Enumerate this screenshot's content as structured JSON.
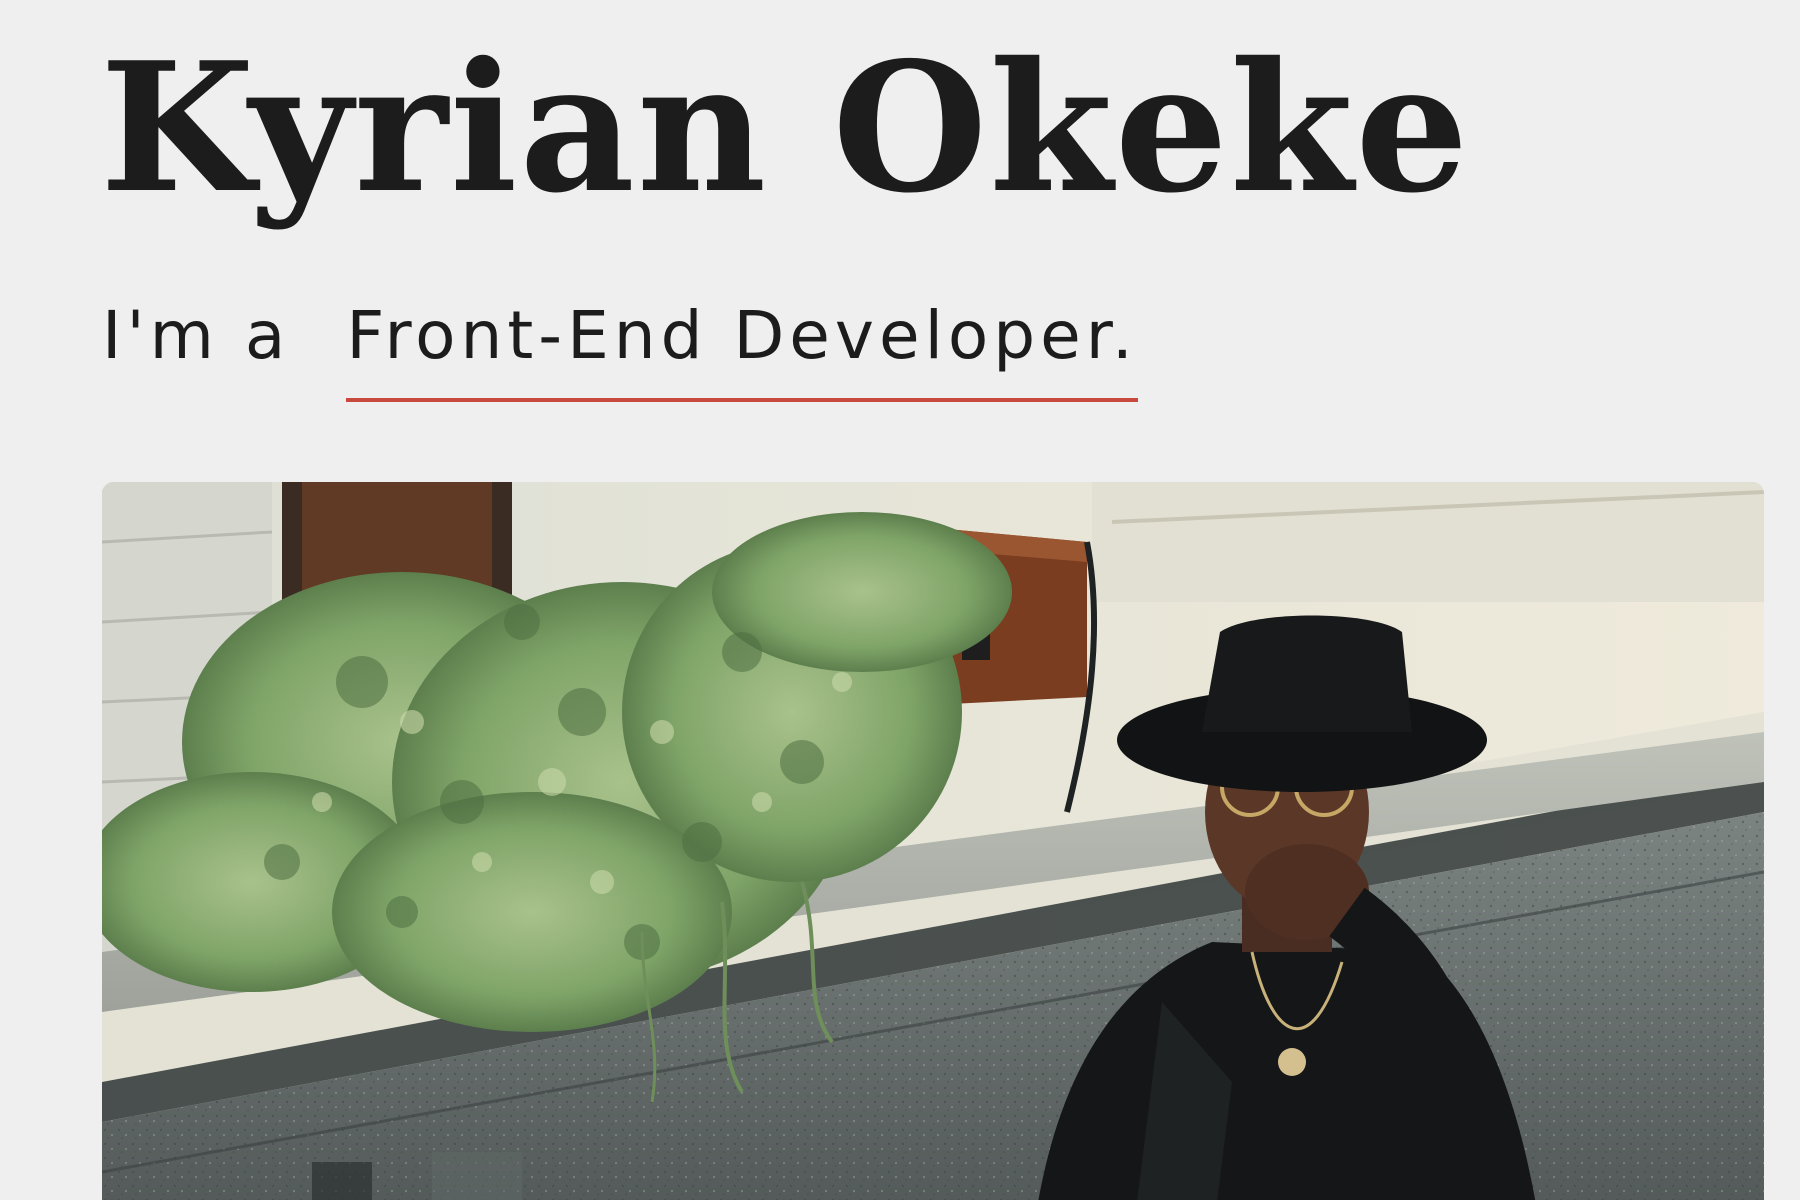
{
  "hero": {
    "name": "Kyrian Okeke",
    "intro_prefix": "I'm a",
    "role": "Front-End Developer."
  },
  "colors": {
    "background": "#efefef",
    "text": "#1c1c1c",
    "accent_underline": "#c8483b"
  }
}
